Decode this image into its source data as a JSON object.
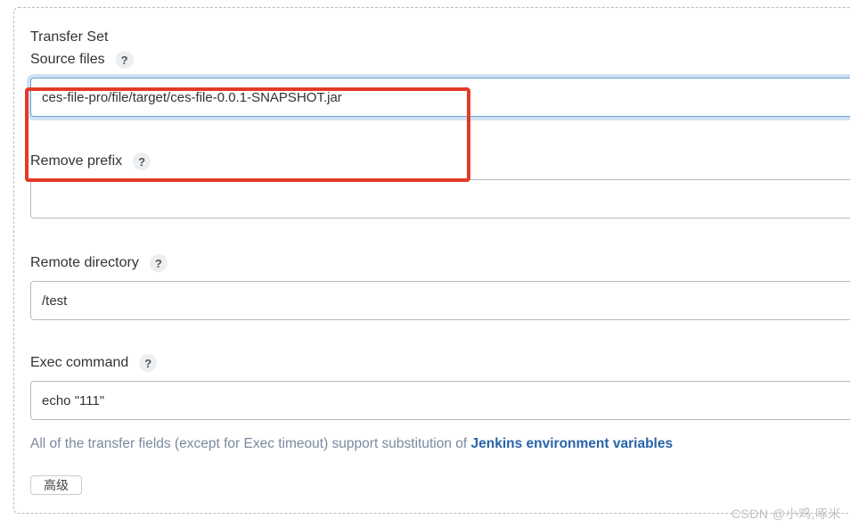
{
  "section": {
    "title": "Transfer Set"
  },
  "fields": {
    "source_files": {
      "label": "Source files",
      "value": "ces-file-pro/file/target/ces-file-0.0.1-SNAPSHOT.jar"
    },
    "remove_prefix": {
      "label": "Remove prefix",
      "value": ""
    },
    "remote_directory": {
      "label": "Remote directory",
      "value": "/test"
    },
    "exec_command": {
      "label": "Exec command",
      "value": "echo \"111\""
    }
  },
  "help_glyph": "?",
  "hint": {
    "prefix": "All of the transfer fields (except for Exec timeout) support substitution of ",
    "link": "Jenkins environment variables"
  },
  "button_stub": "高级",
  "watermark": "CSDN @小鸡,啄米"
}
